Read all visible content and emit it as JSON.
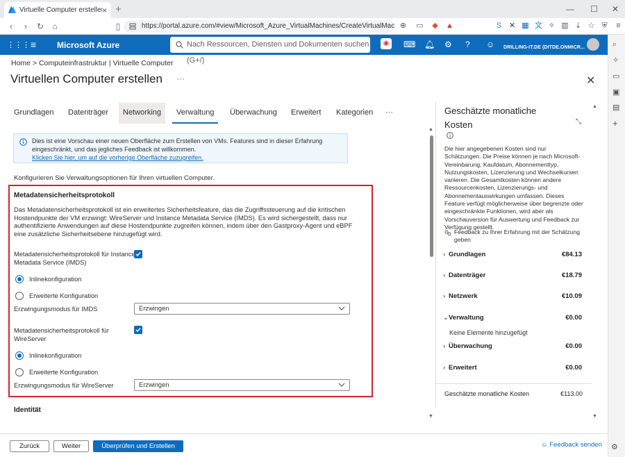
{
  "browser": {
    "tab_title": "Virtuelle Computer erstellen - I",
    "url": "https://portal.azure.com/#view/Microsoft_Azure_VirtualMachines/CreateVirtualMachine.Rea..."
  },
  "azure": {
    "brand": "Microsoft Azure",
    "search_placeholder": "Nach Ressourcen, Diensten und Dokumenten suchen (G+/)",
    "tenant": "DRILLING-IT.DE (DITDE.ONMICR..."
  },
  "breadcrumb": "Home > Computeinfrastruktur | Virtuelle Computer",
  "page_title": "Virtuellen Computer erstellen",
  "page_more": "···",
  "tabs": [
    "Grundlagen",
    "Datenträger",
    "Networking",
    "Verwaltung",
    "Überwachung",
    "Erweitert",
    "Kategorien",
    "···"
  ],
  "info": {
    "text": "Dies ist eine Vorschau einer neuen Oberfläche zum Erstellen von VMs. Features sind in dieser Erfahrung eingeschränkt, und das jegliches Feedback ist willkommen.",
    "link": "Klicken Sie hier, um auf die vorherige Oberfläche zuzugreifen."
  },
  "intro": "Konfigurieren Sie Verwaltungsoptionen für Ihren virtuellen Computer.",
  "section": {
    "title": "Metadatensicherheitsprotokoll",
    "description": "Das Metadatensicherheitsprotokoll ist ein erweitertes Sicherheitsfeature, das die Zugriffssteuerung auf die kritischen Hostendpunkte der VM erzwingt: WireServer und Instance Metadata Service (IMDS). Es wird sichergestellt, dass nur authentifizierte Anwendungen auf diese Hostendpunkte zugreifen können, indem über den Gastproxy-Agent und eBPF eine zusätzliche Sicherheitsebene hinzugefügt wird.",
    "imds_label": "Metadatensicherheitsprotokoll für Instance Metadata Service (IMDS)",
    "imds_checked": true,
    "radio_inline": "Inlinekonfiguration",
    "radio_advanced": "Erweiterte Konfiguration",
    "imds_mode_label": "Erzwingungsmodus für IMDS",
    "imds_mode_value": "Erzwingen",
    "wire_label": "Metadatensicherheitsprotokoll für WireServer",
    "wire_checked": true,
    "wire_mode_label": "Erzwingungsmodus für WireServer",
    "wire_mode_value": "Erzwingen"
  },
  "identity_title": "Identität",
  "cost": {
    "title": "Geschätzte monatliche Kosten",
    "description": "Die hier angegebenen Kosten sind nur Schätzungen. Die Preise können je nach Microsoft-Vereinbarung, Kaufdatum, Abonnementtyp, Nutzungskosten, Lizenzierung und Wechselkursen variieren. Die Gesamtkosten können andere Ressourcenkosten, Lizenzierungs- und Abonnementauswirkungen umfassen. Dieses Feature verfügt möglicherweise über begrenzte oder eingeschränkte Funktionen, wird aber als Vorschauversion für Auswertung und Feedback zur Verfügung gestellt.",
    "feedback": "Feedback zu Ihrer Erfahrung mit der Schätzung geben",
    "rows": [
      {
        "name": "Grundlagen",
        "value": "€84.13"
      },
      {
        "name": "Datenträger",
        "value": "€18.79"
      },
      {
        "name": "Netzwerk",
        "value": "€10.09"
      },
      {
        "name": "Verwaltung",
        "value": "€0.00"
      },
      {
        "name": "Überwachung",
        "value": "€0.00"
      },
      {
        "name": "Erweitert",
        "value": "€0.00"
      }
    ],
    "no_elements": "Keine Elemente hinzugefügt",
    "total_label": "Geschätzte monatliche Kosten",
    "total_value": "€113.00"
  },
  "footer": {
    "back": "Zurück",
    "next": "Weiter",
    "review": "Überprüfen und Erstellen",
    "feedback": "Feedback senden"
  },
  "colors": {
    "azure_blue": "#0f6cbd",
    "highlight_red": "#d1242f"
  }
}
